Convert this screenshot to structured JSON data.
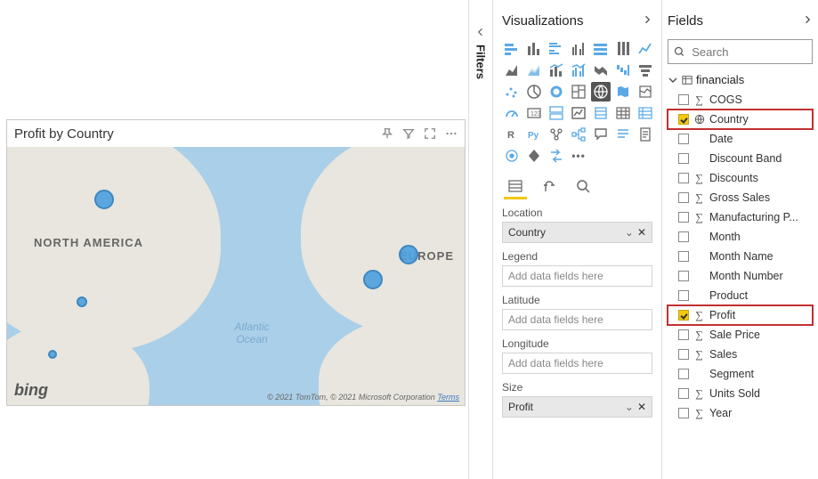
{
  "panes": {
    "filters": "Filters",
    "visualizations": {
      "title": "Visualizations"
    },
    "fields": {
      "title": "Fields"
    }
  },
  "map": {
    "title": "Profit by Country",
    "labels": {
      "na": "NORTH AMERICA",
      "eu": "EUROPE",
      "ocean": "Atlantic Ocean"
    },
    "brand": "bing",
    "attribution": "© 2021 TomTom, © 2021 Microsoft Corporation",
    "terms": "Terms"
  },
  "wells": {
    "location": {
      "label": "Location",
      "value": "Country"
    },
    "legend": {
      "label": "Legend",
      "placeholder": "Add data fields here"
    },
    "latitude": {
      "label": "Latitude",
      "placeholder": "Add data fields here"
    },
    "longitude": {
      "label": "Longitude",
      "placeholder": "Add data fields here"
    },
    "size": {
      "label": "Size",
      "value": "Profit"
    }
  },
  "search": {
    "placeholder": "Search"
  },
  "table": {
    "name": "financials"
  },
  "fields_list": [
    {
      "name": "COGS",
      "icon": "sigma",
      "checked": false
    },
    {
      "name": "Country",
      "icon": "globe",
      "checked": true,
      "highlight": true
    },
    {
      "name": "Date",
      "icon": "",
      "checked": false
    },
    {
      "name": "Discount Band",
      "icon": "",
      "checked": false
    },
    {
      "name": "Discounts",
      "icon": "sigma",
      "checked": false
    },
    {
      "name": "Gross Sales",
      "icon": "sigma",
      "checked": false
    },
    {
      "name": "Manufacturing P...",
      "icon": "sigma",
      "checked": false
    },
    {
      "name": "Month",
      "icon": "",
      "checked": false
    },
    {
      "name": "Month Name",
      "icon": "",
      "checked": false
    },
    {
      "name": "Month Number",
      "icon": "",
      "checked": false
    },
    {
      "name": "Product",
      "icon": "",
      "checked": false
    },
    {
      "name": "Profit",
      "icon": "sigma",
      "checked": true,
      "highlight": true
    },
    {
      "name": "Sale Price",
      "icon": "sigma",
      "checked": false
    },
    {
      "name": "Sales",
      "icon": "sigma",
      "checked": false
    },
    {
      "name": "Segment",
      "icon": "",
      "checked": false
    },
    {
      "name": "Units Sold",
      "icon": "sigma",
      "checked": false
    },
    {
      "name": "Year",
      "icon": "sigma",
      "checked": false
    }
  ]
}
